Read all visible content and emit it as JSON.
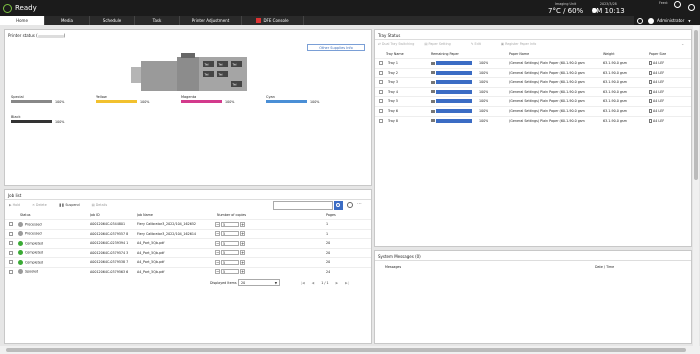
{
  "app": {
    "name": "Ready"
  },
  "environment": {
    "label": "Imaging Unit",
    "value": "7°C / 60%"
  },
  "clock": {
    "date": "2023/3/28",
    "time": "PM 10:13",
    "sun_label": "Feed:"
  },
  "user": {
    "name": "Administrator"
  },
  "tabs": [
    {
      "label": "Home",
      "active": true
    },
    {
      "label": "Media",
      "active": false
    },
    {
      "label": "Schedule",
      "active": false
    },
    {
      "label": "Task",
      "active": false
    },
    {
      "label": "Printer Adjustment",
      "active": false
    },
    {
      "label": "DFE Console",
      "active": false
    }
  ],
  "printer_status": {
    "title": "Printer status (",
    "title_end": ")",
    "other_supplies_label": "Other Supplies Info",
    "tray_labels": [
      "Tel",
      "Tel",
      "Tel",
      "Tel",
      "Tel",
      "Tel"
    ],
    "toners": [
      {
        "name": "Special",
        "pct": "100%",
        "color": "#888888",
        "level": 1.0
      },
      {
        "name": "Yellow",
        "pct": "100%",
        "color": "#f2c12e",
        "level": 1.0
      },
      {
        "name": "Magenta",
        "pct": "100%",
        "color": "#d33a8c",
        "level": 1.0
      },
      {
        "name": "Cyan",
        "pct": "100%",
        "color": "#4a8fd6",
        "level": 1.0
      },
      {
        "name": "Black",
        "pct": "100%",
        "color": "#333333",
        "level": 1.0
      }
    ]
  },
  "job_list": {
    "title": "Job list",
    "toolbar": {
      "hold": "Hold",
      "delete": "Delete",
      "suspend": "Suspend",
      "details": "Details"
    },
    "columns": [
      "Status",
      "Job ID",
      "Job Name",
      "Number of copies",
      "Pages"
    ],
    "rows": [
      {
        "status": "Processed",
        "status_color": "#9a9a9a",
        "job_id": "A0012064C-0344801",
        "name": "Fiery Calibrator3_2022/104_162652",
        "copies": "5",
        "pages": "1"
      },
      {
        "status": "Processed",
        "status_color": "#9a9a9a",
        "job_id": "A0012064C-0379557 8",
        "name": "Fiery Calibrator3_2022/104_162614",
        "copies": "5",
        "pages": "1"
      },
      {
        "status": "Completed",
        "status_color": "#3aaa35",
        "job_id": "A0012064C-0239394 1",
        "name": "A4_Port_5Qb.pdf",
        "copies": "5",
        "pages": "20"
      },
      {
        "status": "Completed",
        "status_color": "#3aaa35",
        "job_id": "A0012064C-0379574 3",
        "name": "A4_Port_5Qb.pdf",
        "copies": "5",
        "pages": "20"
      },
      {
        "status": "Completed",
        "status_color": "#3aaa35",
        "job_id": "A0012064C-0379538 7",
        "name": "A4_Port_5Qb.pdf",
        "copies": "5",
        "pages": "20"
      },
      {
        "status": "Spooled",
        "status_color": "#9a9a9a",
        "job_id": "A0012064C-0379563 6",
        "name": "A4_Port_5Qb.pdf",
        "copies": "5",
        "pages": "24"
      }
    ],
    "pagination": {
      "label": "Displayed Items",
      "per_page": "20",
      "page_info": "1 / 1"
    }
  },
  "tray_status": {
    "title": "Tray Status",
    "toolbar": {
      "dual": "Dual Tray Switching",
      "paper_set": "Paper Setting",
      "edit": "Edit",
      "register": "Register Paper Info"
    },
    "columns": [
      "Tray Name",
      "Remaining Paper",
      "Paper Name",
      "Weight",
      "Paper Size"
    ],
    "rows": [
      {
        "tray": "Tray 1",
        "pct": "100%",
        "paper": "(General Settings) Plain Paper (60.1-90.0 gsm",
        "weight": "63.1-90.0 gsm",
        "size": "A4 LEF"
      },
      {
        "tray": "Tray 2",
        "pct": "100%",
        "paper": "(General Settings) Plain Paper (60.1-90.0 gsm",
        "weight": "63.1-90.0 gsm",
        "size": "A4 LEF"
      },
      {
        "tray": "Tray 3",
        "pct": "100%",
        "paper": "(General Settings) Plain Paper (60.1-90.0 gsm",
        "weight": "63.1-90.0 gsm",
        "size": "A4 LEF"
      },
      {
        "tray": "Tray 4",
        "pct": "100%",
        "paper": "(General Settings) Plain Paper (60.1-90.0 gsm",
        "weight": "63.1-90.0 gsm",
        "size": "A4 LEF"
      },
      {
        "tray": "Tray 5",
        "pct": "100%",
        "paper": "(General Settings) Plain Paper (60.1-90.0 gsm",
        "weight": "63.1-90.0 gsm",
        "size": "A4 LEF"
      },
      {
        "tray": "Tray 6",
        "pct": "100%",
        "paper": "(General Settings) Plain Paper (60.1-90.0 gsm",
        "weight": "63.1-90.0 gsm",
        "size": "A4 LEF"
      },
      {
        "tray": "Tray 8",
        "pct": "100%",
        "paper": "(General Settings) Plain Paper (60.1-90.0 gsm",
        "weight": "63.1-90.0 gsm",
        "size": "A4 LEF"
      }
    ]
  },
  "system_messages": {
    "title": "System Messages (0)",
    "columns": [
      "Messages",
      "Date / Time"
    ]
  }
}
